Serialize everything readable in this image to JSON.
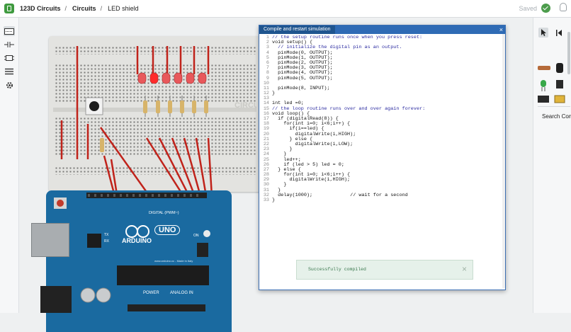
{
  "breadcrumb": {
    "app": "123D Circuits",
    "sep": "/",
    "section": "Circuits",
    "project": "LED shield"
  },
  "status": {
    "saved_label": "Saved"
  },
  "dialog": {
    "tab_label": "Compile and restart simulation",
    "close_label": "×",
    "code_lines": [
      {
        "n": "1",
        "t": "// the setup routine runs once when you press reset:",
        "cm": true
      },
      {
        "n": "2",
        "t": "void setup() {",
        "cm": false
      },
      {
        "n": "3",
        "t": "  // initialize the digital pin as an output.",
        "cm": true
      },
      {
        "n": "4",
        "t": "  pinMode(0, OUTPUT);",
        "cm": false
      },
      {
        "n": "5",
        "t": "  pinMode(1, OUTPUT);",
        "cm": false
      },
      {
        "n": "6",
        "t": "  pinMode(2, OUTPUT);",
        "cm": false
      },
      {
        "n": "7",
        "t": "  pinMode(3, OUTPUT);",
        "cm": false
      },
      {
        "n": "8",
        "t": "  pinMode(4, OUTPUT);",
        "cm": false
      },
      {
        "n": "9",
        "t": "  pinMode(5, OUTPUT);",
        "cm": false
      },
      {
        "n": "10",
        "t": "",
        "cm": false
      },
      {
        "n": "11",
        "t": "  pinMode(8, INPUT);",
        "cm": false
      },
      {
        "n": "12",
        "t": "}",
        "cm": false
      },
      {
        "n": "13",
        "t": "",
        "cm": false
      },
      {
        "n": "14",
        "t": "int led =0;",
        "cm": false
      },
      {
        "n": "15",
        "t": "// the loop routine runs over and over again forever:",
        "cm": true
      },
      {
        "n": "16",
        "t": "void loop() {",
        "cm": false
      },
      {
        "n": "17",
        "t": "  if (digitalRead(8)) {",
        "cm": false
      },
      {
        "n": "18",
        "t": "    for(int i=0; i<6;i++) {",
        "cm": false
      },
      {
        "n": "19",
        "t": "      if(i==led) {",
        "cm": false
      },
      {
        "n": "20",
        "t": "        digitalWrite(i,HIGH);",
        "cm": false
      },
      {
        "n": "21",
        "t": "      } else {",
        "cm": false
      },
      {
        "n": "22",
        "t": "        digitalWrite(i,LOW);",
        "cm": false
      },
      {
        "n": "23",
        "t": "      }",
        "cm": false
      },
      {
        "n": "24",
        "t": "    }",
        "cm": false
      },
      {
        "n": "25",
        "t": "    led++;",
        "cm": false
      },
      {
        "n": "26",
        "t": "    if (led > 5) led = 0;",
        "cm": false
      },
      {
        "n": "27",
        "t": "  } else {",
        "cm": false
      },
      {
        "n": "28",
        "t": "    for(int i=0; i<6;i++) {",
        "cm": false
      },
      {
        "n": "29",
        "t": "      digitalWrite(i,HIGH);",
        "cm": false
      },
      {
        "n": "30",
        "t": "    }",
        "cm": false
      },
      {
        "n": "31",
        "t": "  }",
        "cm": false
      },
      {
        "n": "32",
        "t": "  delay(1000);             // wait for a second",
        "cm": false
      },
      {
        "n": "33",
        "t": "}",
        "cm": false
      }
    ],
    "toast": {
      "message": "Successfully compiled",
      "close_label": "×"
    }
  },
  "breadboard": {
    "label": "CIRCUI"
  },
  "arduino": {
    "logo_text": "UNO",
    "brand_text": "ARDUINO",
    "digital_label": "DIGITAL (PWM~)",
    "power_label": "POWER",
    "analog_label": "ANALOG IN",
    "web_text": "www.arduino.cc - Made in Italy",
    "on_label": "ON",
    "tx_label": "TX",
    "rx_label": "RX"
  },
  "rightpanel": {
    "search_label": "Search Com"
  },
  "colors": {
    "wire": "#c0231b",
    "led": "#e8585b",
    "board_blue": "#1a6aa0",
    "accent": "#2f6bb5"
  }
}
